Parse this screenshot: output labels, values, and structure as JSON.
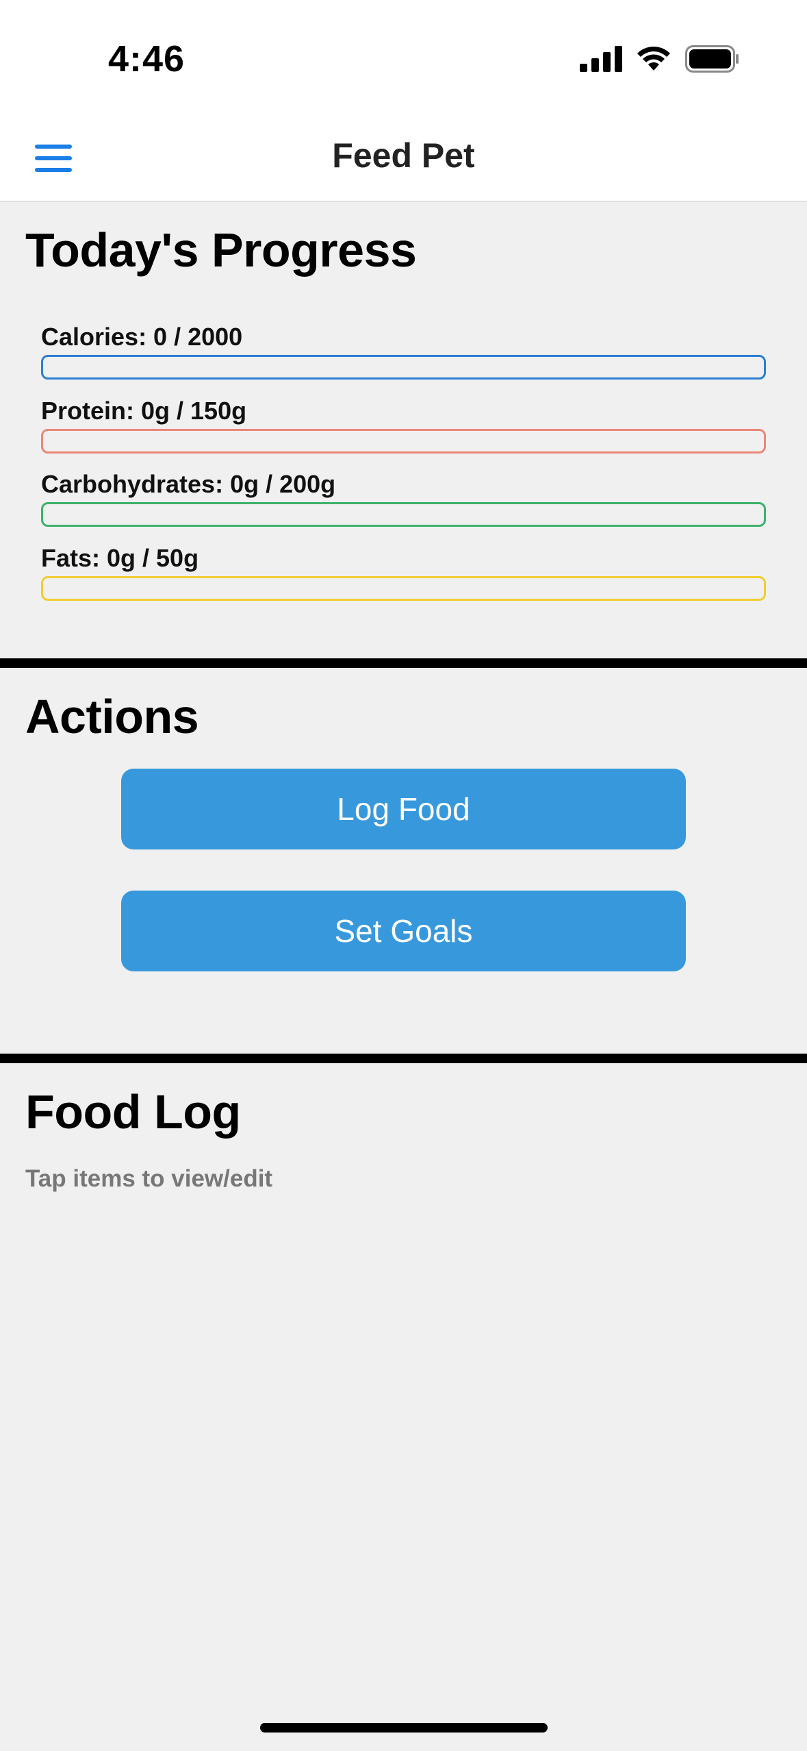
{
  "status_bar": {
    "time": "4:46"
  },
  "nav": {
    "title": "Feed Pet",
    "menu_icon": "hamburger-menu-icon"
  },
  "progress": {
    "title": "Today's Progress",
    "items": [
      {
        "label": "Calories: 0 / 2000",
        "color": "#2a7fd4",
        "fraction": 0
      },
      {
        "label": "Protein: 0g / 150g",
        "color": "#ec8677",
        "fraction": 0
      },
      {
        "label": "Carbohydrates: 0g / 200g",
        "color": "#3db26a",
        "fraction": 0
      },
      {
        "label": "Fats: 0g / 50g",
        "color": "#f2cd2e",
        "fraction": 0
      }
    ]
  },
  "actions": {
    "title": "Actions",
    "log_food_label": "Log Food",
    "set_goals_label": "Set Goals",
    "button_color": "#3799dc"
  },
  "food_log": {
    "title": "Food Log",
    "hint": "Tap items to view/edit"
  }
}
